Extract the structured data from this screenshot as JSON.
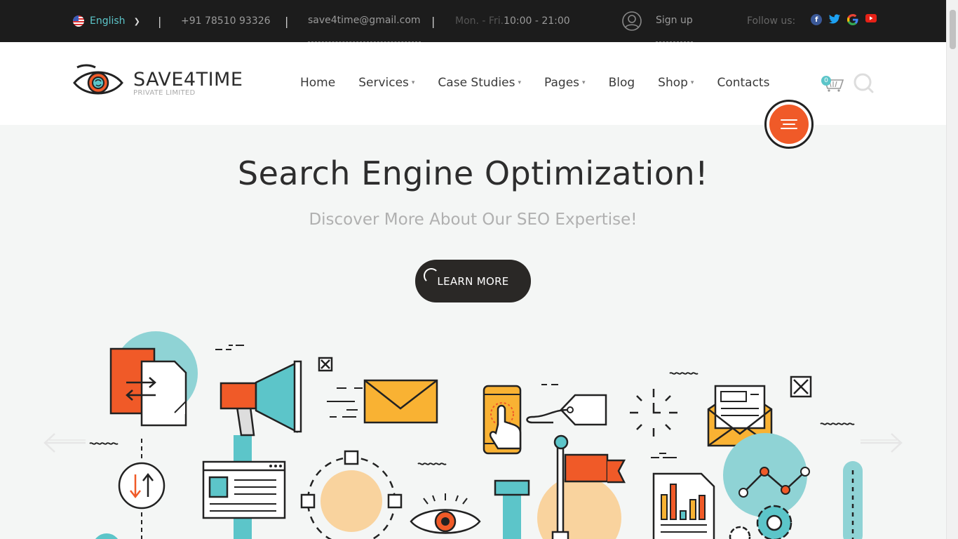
{
  "topbar": {
    "language": "English",
    "separator": "|",
    "phone": "+91 78510 93326",
    "email": "save4time@gmail.com",
    "hours_label": "Mon. - Fri.",
    "hours_value": "10:00 - 21:00",
    "signup": "Sign up",
    "follow_label": "Follow us:",
    "social": [
      "facebook-icon",
      "twitter-icon",
      "google-icon",
      "youtube-icon"
    ]
  },
  "header": {
    "brand": "SAVE4TIME",
    "brand_sub": "PRIVATE LIMITED",
    "nav": [
      {
        "label": "Home",
        "dropdown": false
      },
      {
        "label": "Services",
        "dropdown": true
      },
      {
        "label": "Case Studies",
        "dropdown": true
      },
      {
        "label": "Pages",
        "dropdown": true
      },
      {
        "label": "Blog",
        "dropdown": false
      },
      {
        "label": "Shop",
        "dropdown": true
      },
      {
        "label": "Contacts",
        "dropdown": false
      }
    ],
    "cart_count": "0"
  },
  "hero": {
    "title": "Search Engine Optimization!",
    "subtitle": "Discover More About Our SEO Expertise!",
    "cta": "LEARN MORE"
  },
  "colors": {
    "accent_orange": "#f05a28",
    "accent_teal": "#5cc5c9",
    "topbar_bg": "#1c1c1c",
    "hero_bg": "#f4f6f5",
    "dark": "#2a2826",
    "yellow": "#f9b233",
    "peach": "#f9d39e"
  }
}
